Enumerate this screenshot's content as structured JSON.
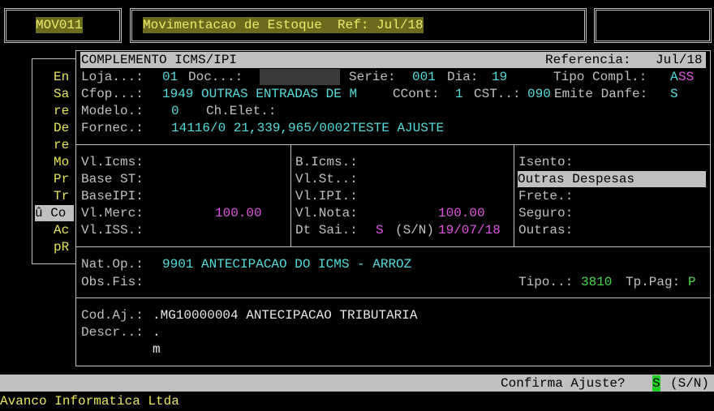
{
  "header": {
    "program_code": "MOV011",
    "title": "Movimentacao de Estoque  Ref: Jul/18",
    "right_box": ""
  },
  "side_menu": [
    "En",
    "Sa",
    "re",
    "De",
    "re",
    "Mo",
    "Pr",
    "Tr",
    "û Co",
    "Ac",
    "pR"
  ],
  "dialog": {
    "title": "COMPLEMENTO ICMS/IPI",
    "ref_label": "Referencia:",
    "ref_value": "Jul/18",
    "loja_label": "Loja...:",
    "loja_value": "01",
    "doc_label": "Doc...:",
    "serie_label": "Serie:",
    "serie_value": "001",
    "dia_label": "Dia:",
    "dia_value": "19",
    "tipo_compl_label": "Tipo Compl.:",
    "tipo_compl_value_a": "A",
    "tipo_compl_value_b": "SS",
    "cfop_label": "Cfop...:",
    "cfop_value": "1949 OUTRAS ENTRADAS DE M",
    "ccont_label": "CCont:",
    "ccont_value": "1",
    "cst_label": "CST..:",
    "cst_value": "090",
    "emite_label": "Emite Danfe:",
    "emite_value": "S",
    "modelo_label": "Modelo.:",
    "modelo_value": "0",
    "chelet_label": "Ch.Elet.:",
    "fornec_label": "Fornec.:",
    "fornec_value": "14116/0 21,339,965/0002TESTE AJUSTE",
    "col1": {
      "vl_icms": "Vl.Icms:",
      "base_st": "Base ST:",
      "base_ipi": "BaseIPI:",
      "vl_merc": "Vl.Merc:",
      "vl_merc_value": "100.00",
      "vl_iss": "Vl.ISS.:"
    },
    "col2": {
      "b_icms": "B.Icms.:",
      "vl_st": "Vl.St..:",
      "vl_ipi": "Vl.IPI.:",
      "vl_nota": "Vl.Nota:",
      "vl_nota_value": "100.00",
      "dt_sai": "Dt Sai.:",
      "dt_sai_flag": "S",
      "dt_sai_sn": "(S/N)",
      "dt_sai_date": "19/07/18"
    },
    "col3": {
      "isento": "Isento:",
      "outras_despesas": "Outras Despesas",
      "frete": "Frete.:",
      "seguro": "Seguro:",
      "outras": "Outras:"
    },
    "natop_label": "Nat.Op.:",
    "natop_value": "9901 ANTECIPACAO DO ICMS - ARROZ",
    "obsfis_label": "Obs.Fis:",
    "tipo_label": "Tipo..:",
    "tipo_value": "3810",
    "tppag_label": "Tp.Pag:",
    "tppag_value": "P",
    "codaj_label": "Cod.Aj.:",
    "codaj_value": ".MG10000004 ANTECIPACAO TRIBUTARIA",
    "descr_label": "Descr..:",
    "descr_value": ".",
    "descr_line2": "m"
  },
  "status": {
    "prompt": "Confirma Ajuste?",
    "answer": "S",
    "options": "(S/N)"
  },
  "footer": {
    "company": "Avanco Informatica Ltda"
  },
  "colors": {
    "yellow": "#e6e65a",
    "cyan": "#55dcdc",
    "magenta": "#e055e0",
    "green": "#4ad84a",
    "grey": "#c0c0c0"
  }
}
